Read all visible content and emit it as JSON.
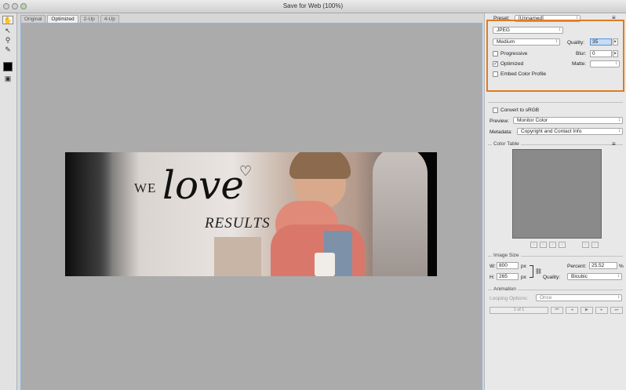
{
  "window": {
    "title": "Save for Web (100%)"
  },
  "toolbox": {
    "tools": [
      {
        "name": "hand-tool-icon",
        "glyph": "✋"
      },
      {
        "name": "slice-select-tool-icon",
        "glyph": "↖"
      },
      {
        "name": "zoom-tool-icon",
        "glyph": "⚲"
      },
      {
        "name": "eyedropper-tool-icon",
        "glyph": "✎"
      },
      {
        "name": "preview-toggle-icon",
        "glyph": "▣"
      }
    ],
    "eyedropper_color": "#000000"
  },
  "tabs": [
    "Original",
    "Optimized",
    "2-Up",
    "4-Up"
  ],
  "active_tab": "Optimized",
  "banner": {
    "word_we": "WE",
    "word_love": "love",
    "word_results": "RESULTS"
  },
  "panel": {
    "preset_label": "Preset:",
    "preset_value": "[Unnamed]",
    "format": "JPEG",
    "quality_level": "Medium",
    "quality_label": "Quality:",
    "quality_value": "35",
    "progressive_label": "Progressive",
    "progressive_checked": false,
    "blur_label": "Blur:",
    "blur_value": "0",
    "optimized_label": "Optimized",
    "optimized_checked": true,
    "matte_label": "Matte:",
    "matte_value": "",
    "embed_label": "Embed Color Profile",
    "embed_checked": false,
    "convert_label": "Convert to sRGB",
    "convert_checked": false,
    "preview_label": "Preview:",
    "preview_value": "Monitor Color",
    "metadata_label": "Metadata:",
    "metadata_value": "Copyright and Contact Info",
    "color_table_title": "Color Table",
    "image_size_title": "Image Size",
    "w_label": "W:",
    "w_value": "800",
    "h_label": "H:",
    "h_value": "265",
    "px_unit": "px",
    "percent_label": "Percent:",
    "percent_value": "25.52",
    "percent_unit": "%",
    "size_quality_label": "Quality:",
    "size_quality_value": "Bicubic",
    "animation_title": "Animation",
    "looping_label": "Looping Options:",
    "looping_value": "Once",
    "frame_counter": "1 of 1",
    "highlight_color": "#e07b24"
  }
}
